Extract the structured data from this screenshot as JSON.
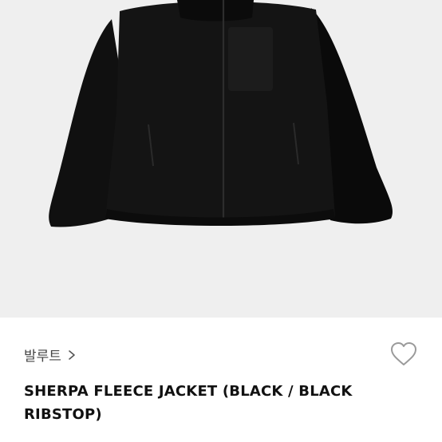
{
  "product": {
    "image_alt": "SHERPA FLEECE JACKET",
    "brand_label": "발루트",
    "brand_chevron_icon": "chevron-right-icon",
    "wishlist_icon": "heart-outline-icon",
    "title": "SHERPA FLEECE JACKET (BLACK / BLACK RIBSTOP)"
  },
  "colors": {
    "hero_bg": "#efefef",
    "jacket": "#0d0d0d",
    "heart_stroke": "#9a9a9a",
    "brand_text": "#444444",
    "title_text": "#111111"
  }
}
